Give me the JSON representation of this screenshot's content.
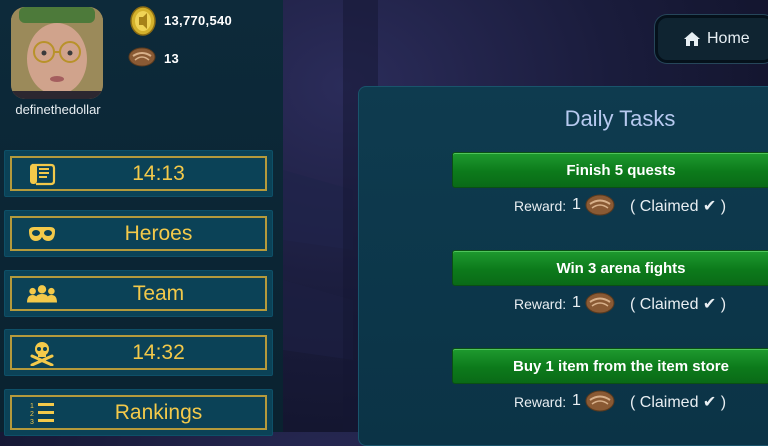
{
  "profile": {
    "username": "definethedollar"
  },
  "resources": {
    "coins": "13,770,540",
    "bread": "13"
  },
  "menu": [
    {
      "label": "14:13",
      "icon": "scroll-icon"
    },
    {
      "label": "Heroes",
      "icon": "mask-icon"
    },
    {
      "label": "Team",
      "icon": "team-icon"
    },
    {
      "label": "14:32",
      "icon": "skull-crossbones-icon"
    },
    {
      "label": "Rankings",
      "icon": "ranked-list-icon"
    }
  ],
  "home": {
    "label": "Home",
    "icon": "house-icon"
  },
  "daily_tasks": {
    "title": "Daily Tasks",
    "reward_label": "Reward:",
    "tasks": [
      {
        "name": "Finish 5 quests",
        "reward": "1",
        "status_open": "( Claimed",
        "status_close": ")"
      },
      {
        "name": "Win 3 arena fights",
        "reward": "1",
        "status_open": "( Claimed",
        "status_close": ")"
      },
      {
        "name": "Buy 1 item from the item store",
        "reward": "1",
        "status_open": "( Claimed",
        "status_close": ")"
      }
    ]
  },
  "colors": {
    "accent_gold": "#f3c94a",
    "task_green": "#0c7a1b",
    "panel_teal": "#0e3b4f"
  }
}
